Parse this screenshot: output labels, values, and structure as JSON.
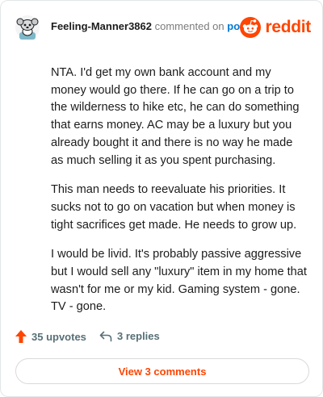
{
  "comment": {
    "username": "Feeling-Manner3862",
    "action_text": "commented on",
    "post_link": "post",
    "paragraphs": [
      "NTA. I'd get my own bank account and my money would go there. If he can go on a trip to the wilderness to hike etc, he can do something that earns money. AC may be a luxury but you already bought it and there is no way he made as much selling it as you spent purchasing.",
      "This man needs to reevaluate his priorities. It sucks not to go on vacation but when money is tight sacrifices get made. He needs to grow up.",
      "I would be livid. It's probably passive aggressive but I would sell any \"luxury\" item in my home that wasn't for me or my kid. Gaming system - gone. TV - gone."
    ]
  },
  "brand": {
    "wordmark": "reddit",
    "color": "#ff4500",
    "icon": "reddit-snoo-icon"
  },
  "footer": {
    "upvotes": "35 upvotes",
    "replies": "3 replies",
    "upvote_icon": "upvote-arrow-icon",
    "reply_icon": "reply-arrow-icon"
  },
  "view_comments_label": "View 3 comments",
  "colors": {
    "accent": "#ff4500",
    "link": "#0079d3",
    "muted": "#7c7c7c",
    "text": "#1c1c1c"
  }
}
